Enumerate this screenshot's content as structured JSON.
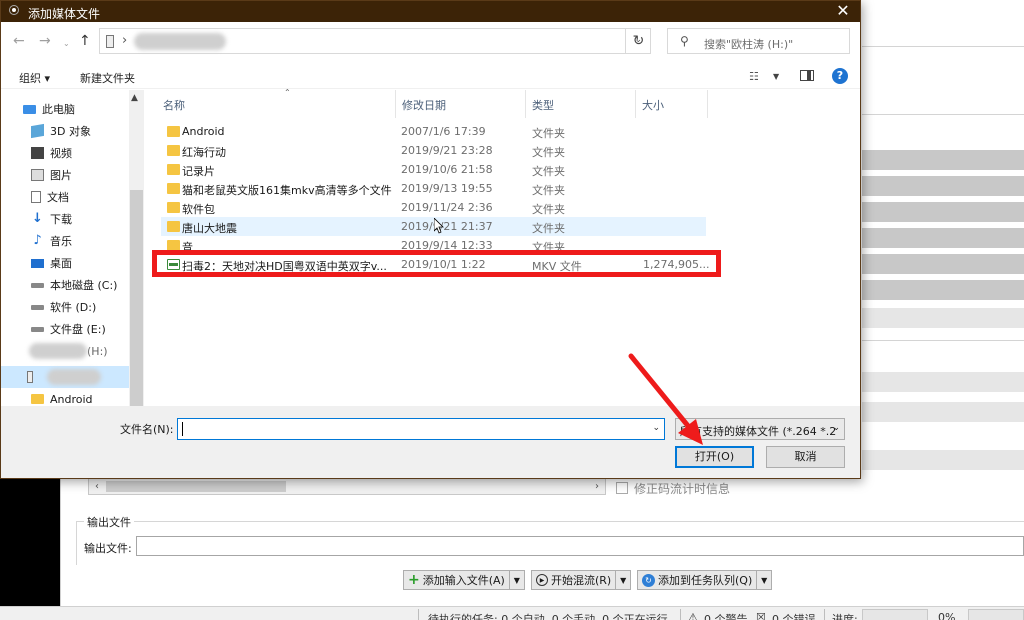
{
  "dialog": {
    "title": "添加媒体文件",
    "search_placeholder": "搜索\"欧柱涛 (H:)\"",
    "toolbar": {
      "organize": "组织 ▾",
      "new_folder": "新建文件夹",
      "help": "?"
    },
    "nav_tree": [
      {
        "label": "此电脑",
        "icon": "pc"
      },
      {
        "label": "3D 对象",
        "icon": "obj3d"
      },
      {
        "label": "视频",
        "icon": "video"
      },
      {
        "label": "图片",
        "icon": "pic"
      },
      {
        "label": "文档",
        "icon": "doc"
      },
      {
        "label": "下载",
        "icon": "down"
      },
      {
        "label": "音乐",
        "icon": "music"
      },
      {
        "label": "桌面",
        "icon": "desk"
      },
      {
        "label": "本地磁盘 (C:)",
        "icon": "disk"
      },
      {
        "label": "软件 (D:)",
        "icon": "disk"
      },
      {
        "label": "文件盘 (E:)",
        "icon": "disk"
      },
      {
        "label": "(H:)",
        "icon": "disk"
      },
      {
        "label": "",
        "icon": "drive",
        "selected": true
      },
      {
        "label": "Android",
        "icon": "folder"
      }
    ],
    "columns": {
      "name": "名称",
      "date": "修改日期",
      "type": "类型",
      "size": "大小"
    },
    "files": [
      {
        "name": "Android",
        "date": "2007/1/6 17:39",
        "type": "文件夹",
        "size": "",
        "icon": "folder"
      },
      {
        "name": "红海行动",
        "date": "2019/9/21 23:28",
        "type": "文件夹",
        "size": "",
        "icon": "folder"
      },
      {
        "name": "记录片",
        "date": "2019/10/6 21:58",
        "type": "文件夹",
        "size": "",
        "icon": "folder"
      },
      {
        "name": "猫和老鼠英文版161集mkv高清等多个文件",
        "date": "2019/9/13 19:55",
        "type": "文件夹",
        "size": "",
        "icon": "folder"
      },
      {
        "name": "软件包",
        "date": "2019/11/24 2:36",
        "type": "文件夹",
        "size": "",
        "icon": "folder"
      },
      {
        "name": "唐山大地震",
        "date": "2019/9/21 21:37",
        "type": "文件夹",
        "size": "",
        "icon": "folder",
        "hover": true
      },
      {
        "name": "音",
        "date": "2019/9/14 12:33",
        "type": "文件夹",
        "size": "",
        "icon": "folder"
      },
      {
        "name": "扫毒2：天地对决HD国粤双语中英双字v...",
        "date": "2019/10/1 1:22",
        "type": "MKV 文件",
        "size": "1,274,905...",
        "icon": "mkv"
      }
    ],
    "filename_label": "文件名(N):",
    "filename_value": "",
    "filter_value": "所有支持的媒体文件 (*.264 *.2",
    "open_button": "打开(O)",
    "cancel_button": "取消"
  },
  "background": {
    "fix_stream_label": "修正码流计时信息",
    "output_group": "输出文件",
    "output_label": "输出文件:",
    "buttons": {
      "add_input": "添加输入文件(A)",
      "start_mux": "开始混流(R)",
      "add_queue": "添加到任务队列(Q)"
    },
    "status": {
      "pending": "待执行的任务: 0 个自动, 0 个手动, 0 个正在运行",
      "warnings": "0 个警告",
      "errors": "0 个错误",
      "progress_label": "进度:",
      "progress_value": "0%"
    }
  }
}
